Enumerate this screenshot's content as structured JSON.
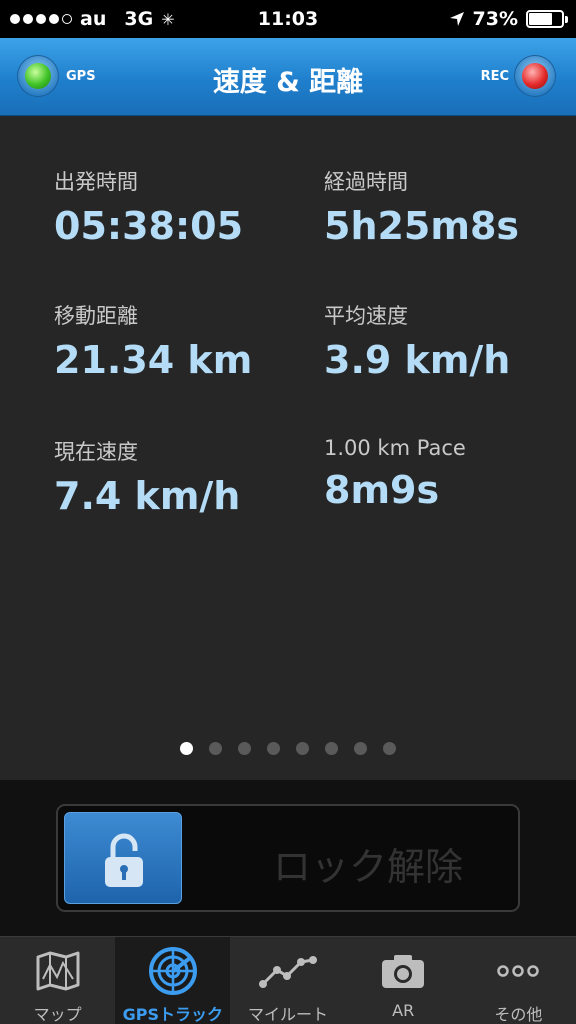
{
  "status_bar": {
    "carrier": "au",
    "network": "3G",
    "time": "11:03",
    "battery": "73%",
    "battery_level": 0.73,
    "signal_bars": 4
  },
  "header": {
    "title": "速度 & 距離",
    "gps_label": "GPS",
    "rec_label": "REC"
  },
  "stats": {
    "departure_time": {
      "label": "出発時間",
      "value": "05:38:05"
    },
    "elapsed_time": {
      "label": "経過時間",
      "value": "5h25m8s"
    },
    "distance": {
      "label": "移動距離",
      "value": "21.34 km"
    },
    "average_speed": {
      "label": "平均速度",
      "value": "3.9 km/h"
    },
    "current_speed": {
      "label": "現在速度",
      "value": "7.4 km/h"
    },
    "pace": {
      "label": "1.00 km Pace",
      "value": "8m9s"
    }
  },
  "pager": {
    "pages": 8,
    "current": 1
  },
  "lock": {
    "label": "ロック解除"
  },
  "tabs": [
    {
      "label": "マップ",
      "icon": "map-icon"
    },
    {
      "label": "GPSトラック",
      "icon": "radar-icon"
    },
    {
      "label": "マイルート",
      "icon": "route-icon"
    },
    {
      "label": "AR",
      "icon": "camera-icon"
    },
    {
      "label": "その他",
      "icon": "more-icon"
    }
  ],
  "colors": {
    "accent": "#1f7fcd",
    "value_text": "#b4dcf6",
    "active_tab": "#3b9cf0",
    "gps_led": "#3fc227",
    "rec_led": "#e52a2a"
  }
}
